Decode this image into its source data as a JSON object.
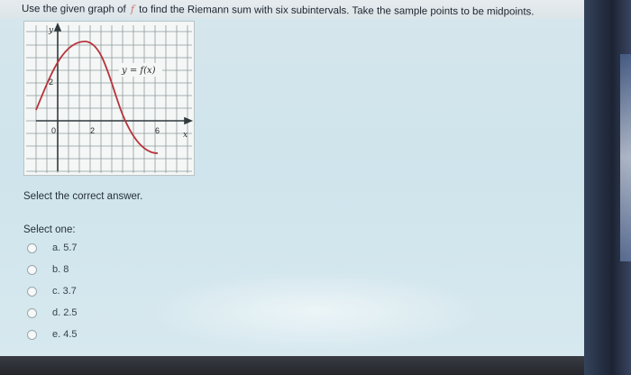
{
  "question": {
    "text_before": "Use the given graph of",
    "function_symbol": "f",
    "text_after": "to find the Riemann sum with six subintervals. Take the sample points to be midpoints."
  },
  "graph": {
    "y_axis_label": "y",
    "x_axis_label": "x",
    "curve_label": "y = f(x)",
    "tick_labels": {
      "y_tick": "2",
      "origin": "0",
      "x_tick_2": "2",
      "x_tick_6": "6"
    },
    "curve_color": "#b8323a"
  },
  "prompt": "Select the correct answer.",
  "select_one": "Select one:",
  "options": [
    {
      "letter": "a.",
      "value": "5.7"
    },
    {
      "letter": "b.",
      "value": "8"
    },
    {
      "letter": "c.",
      "value": "3.7"
    },
    {
      "letter": "d.",
      "value": "2.5"
    },
    {
      "letter": "e.",
      "value": "4.5"
    }
  ]
}
